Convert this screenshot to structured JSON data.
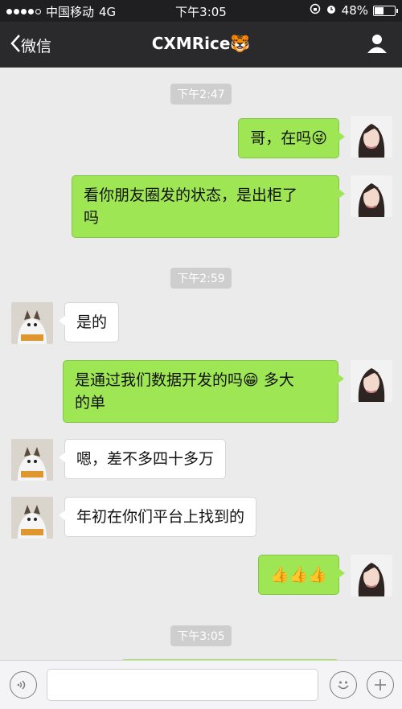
{
  "status_bar": {
    "carrier": "中国移动",
    "network": "4G",
    "time": "下午3:05",
    "battery": "48%"
  },
  "nav": {
    "back_label": "微信",
    "title": "CXMRice🐯"
  },
  "messages": {
    "ts1": "下午2:47",
    "m1": "哥，在吗😜",
    "m2_line1": "看你朋友圈发的状态，是出柜了",
    "m2_line2": "吗",
    "ts2": "下午2:59",
    "m3": "是的",
    "m4_line1": "是通过我们数据开发的吗😁 多大",
    "m4_line2": "的单",
    "m5": "嗯，差不多四十多万",
    "m6": "年初在你们平台上找到的",
    "m7": "👍👍👍",
    "ts3": "下午3:05"
  },
  "input": {
    "placeholder": ""
  },
  "colors": {
    "my_bubble": "#9ee654",
    "their_bubble": "#ffffff",
    "nav_bg": "#2a2a2d"
  }
}
